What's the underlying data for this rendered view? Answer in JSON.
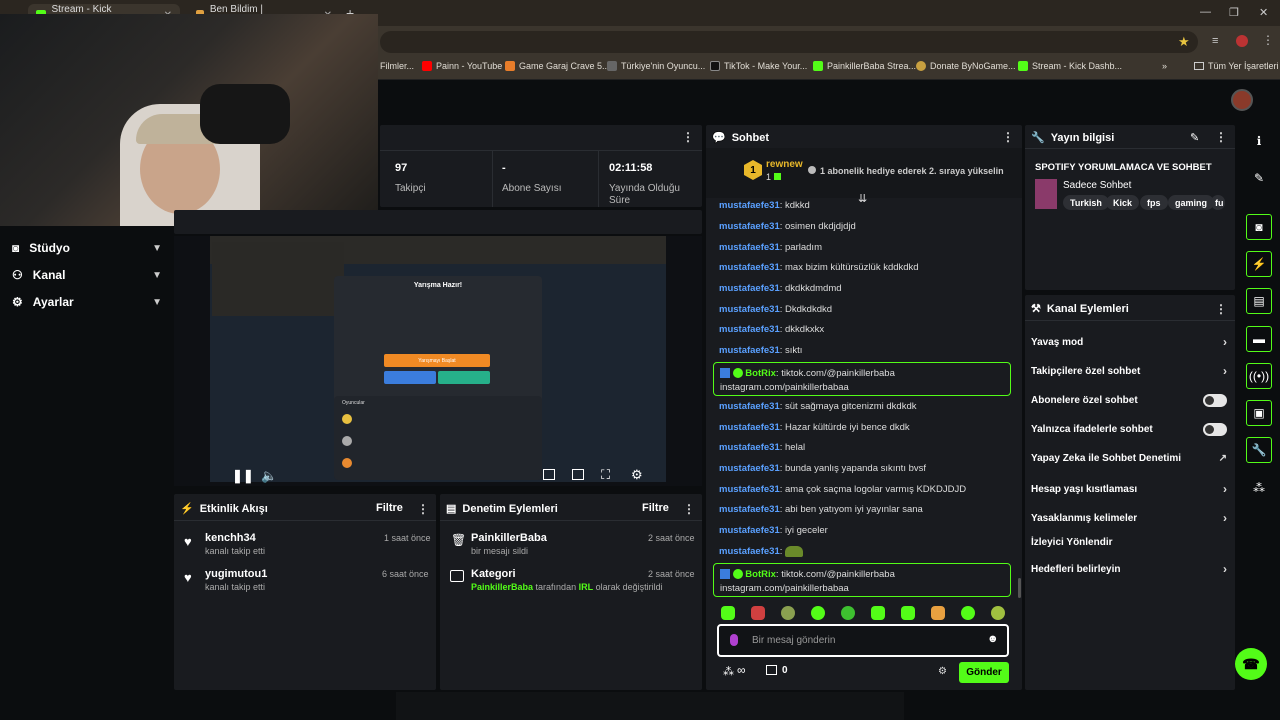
{
  "browser": {
    "tabs": [
      {
        "label": "Stream - Kick Dashboard"
      },
      {
        "label": "Ben Bildim | Arkadaşlarla Onl..."
      }
    ],
    "bookmarks": [
      {
        "label": "Filmler..."
      },
      {
        "label": "Painn - YouTube"
      },
      {
        "label": "Game Garaj Crave 5..."
      },
      {
        "label": "Türkiye'nin Oyuncu..."
      },
      {
        "label": "TikTok - Make Your..."
      },
      {
        "label": "PainkillerBaba Strea..."
      },
      {
        "label": "Donate ByNoGame..."
      },
      {
        "label": "Stream - Kick Dashb..."
      },
      {
        "label": "Tüm Yer İşaretleri"
      }
    ]
  },
  "nav": [
    {
      "label": "Stüdyo"
    },
    {
      "label": "Kanal"
    },
    {
      "label": "Ayarlar"
    }
  ],
  "stats": [
    {
      "value": "97",
      "label": "Takipçi"
    },
    {
      "value": "-",
      "label": "Abone Sayısı"
    },
    {
      "value": "02:11:58",
      "label": "Yayında Olduğu Süre"
    }
  ],
  "video": {
    "overlay_title": "Yarışma Hazır!",
    "start_btn": "Yarışmayı Başlat",
    "players_label": "Oyuncular"
  },
  "activity": {
    "title": "Etkinlik Akışı",
    "filter": "Filtre",
    "events": [
      {
        "name": "kenchh34",
        "sub": "kanalı takip etti",
        "time": "1 saat önce"
      },
      {
        "name": "yugimutou1",
        "sub": "kanalı takip etti",
        "time": "6 saat önce"
      }
    ]
  },
  "moderation": {
    "title": "Denetim Eylemleri",
    "filter": "Filtre",
    "events": [
      {
        "name": "PainkillerBaba",
        "sub": "bir mesajı sildi",
        "time": "2 saat önce"
      },
      {
        "name": "Kategori",
        "sub_user": "PainkillerBaba",
        "sub_mid": "tarafından",
        "sub_cat": "IRL",
        "sub_end": "olarak değiştirildi",
        "time": "2 saat önce"
      }
    ]
  },
  "chat": {
    "title": "Sohbet",
    "top_gifter": {
      "rank": "1",
      "name": "rewnew",
      "count": "1"
    },
    "gift_prompt": "1 abonelik hediye ederek 2. sıraya yükselin",
    "messages": [
      {
        "user": "mustafaefe31",
        "text": "kdkkd"
      },
      {
        "user": "mustafaefe31",
        "text": "osimen dkdjdjdjd"
      },
      {
        "user": "mustafaefe31",
        "text": "parladım"
      },
      {
        "user": "mustafaefe31",
        "text": "max bizim kültürsüzlük kddkdkd"
      },
      {
        "user": "mustafaefe31",
        "text": "dkdkkdmdmd"
      },
      {
        "user": "mustafaefe31",
        "text": "Dkdkdkdkd"
      },
      {
        "user": "mustafaefe31",
        "text": "dkkdkxkx"
      },
      {
        "user": "mustafaefe31",
        "text": "sıktı"
      },
      {
        "user": "mustafaefe31",
        "text": "süt sağmaya gitcenizmi dkdkdk"
      },
      {
        "user": "mustafaefe31",
        "text": "Hazar kültürde iyi bence dkdk"
      },
      {
        "user": "mustafaefe31",
        "text": "helal"
      },
      {
        "user": "mustafaefe31",
        "text": "bunda yanlış yapanda sıkıntı bvsf"
      },
      {
        "user": "mustafaefe31",
        "text": "ama çok saçma logolar varmış KDKDJDJD"
      },
      {
        "user": "mustafaefe31",
        "text": "abi ben yatıyom iyi yayınlar sana"
      },
      {
        "user": "mustafaefe31",
        "text": "iyi geceler"
      },
      {
        "user": "mustafaefe31",
        "text": ""
      }
    ],
    "bot": {
      "user": "BotRix",
      "line1": "tiktok.com/@painkillerbaba",
      "line2": "instagram.com/painkillerbabaa"
    },
    "input_placeholder": "Bir mesaj gönderin",
    "send": "Gönder",
    "infinity": "∞",
    "gift_count": "0"
  },
  "stream_info": {
    "title": "Yayın bilgisi",
    "stream_title": "SPOTIFY YORUMLAMACA VE SOHBET",
    "category": "Sadece Sohbet",
    "tags": [
      "Turkish",
      "Kick",
      "fps",
      "gaming",
      "fu"
    ]
  },
  "channel_actions": {
    "title": "Kanal Eylemleri",
    "items": [
      {
        "label": "Yavaş mod",
        "control": "arrow"
      },
      {
        "label": "Takipçilere özel sohbet",
        "control": "arrow"
      },
      {
        "label": "Abonelere özel sohbet",
        "control": "toggle"
      },
      {
        "label": "Yalnızca ifadelerle sohbet",
        "control": "toggle"
      },
      {
        "label": "Yapay Zeka ile Sohbet Denetimi",
        "control": "external"
      },
      {
        "label": "Hesap yaşı kısıtlaması",
        "control": "arrow"
      },
      {
        "label": "Yasaklanmış kelimeler",
        "control": "arrow"
      },
      {
        "label": "İzleyici Yönlendir",
        "control": "none"
      },
      {
        "label": "Hedefleri belirleyin",
        "control": "arrow"
      }
    ]
  },
  "colors": {
    "accent": "#53fc18",
    "username": "#5aa0ff",
    "panel": "#191b1f"
  }
}
